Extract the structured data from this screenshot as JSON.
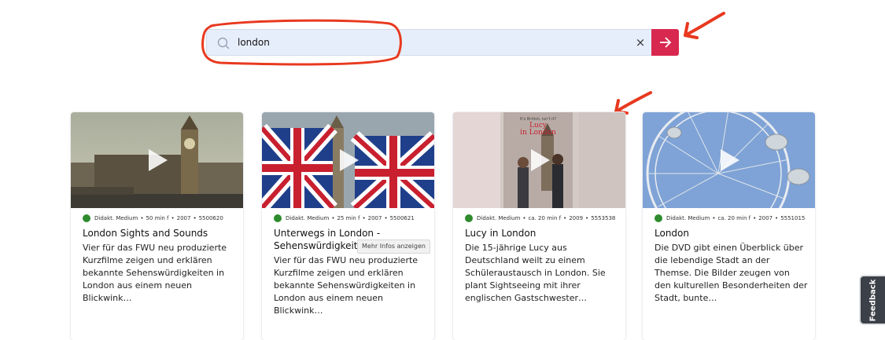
{
  "search": {
    "value": "london",
    "clear_label": "×",
    "icons": {
      "search": "search-icon",
      "clear": "close-icon",
      "submit": "arrow-right-icon"
    },
    "accent_color": "#d8284f"
  },
  "cards": [
    {
      "type": "Didakt. Medium",
      "duration": "50 min f",
      "year": "2007",
      "id": "5500620",
      "title": "London Sights and Sounds",
      "description": "Vier für das FWU neu produzierte Kurzfilme zeigen und erklären bekannte Sehenswürdigkeiten in London aus einem neuen Blickwink…"
    },
    {
      "type": "Didakt. Medium",
      "duration": "25 min f",
      "year": "2007",
      "id": "5500621",
      "title": "Unterwegs in London - Sehenswürdigkeiten",
      "description": "Vier für das FWU neu produzierte Kurzfilme zeigen und erklären bekannte Sehenswürdigkeiten in London aus einem neuen Blickwink…"
    },
    {
      "type": "Didakt. Medium",
      "duration": "ca. 20 min f",
      "year": "2009",
      "id": "5553538",
      "title": "Lucy in London",
      "thumb_caption_small": "It's British, isn't it?",
      "thumb_caption_1": "Lucy",
      "thumb_caption_2": "in London",
      "description": "Die 15-jährige Lucy aus Deutschland weilt zu einem Schüleraustausch in London. Sie plant Sightseeing mit ihrer englischen Gastschwester…"
    },
    {
      "type": "Didakt. Medium",
      "duration": "ca. 20 min f",
      "year": "2007",
      "id": "5551015",
      "title": "London",
      "description": "Die DVD gibt einen Überblick über die lebendige Stadt an der Themse. Die Bilder zeugen von den kulturellen Besonderheiten der Stadt, bunte…"
    }
  ],
  "tooltip": "Mehr Infos anzeigen",
  "feedback_label": "Feedback",
  "status_color": "#2e8b2e"
}
